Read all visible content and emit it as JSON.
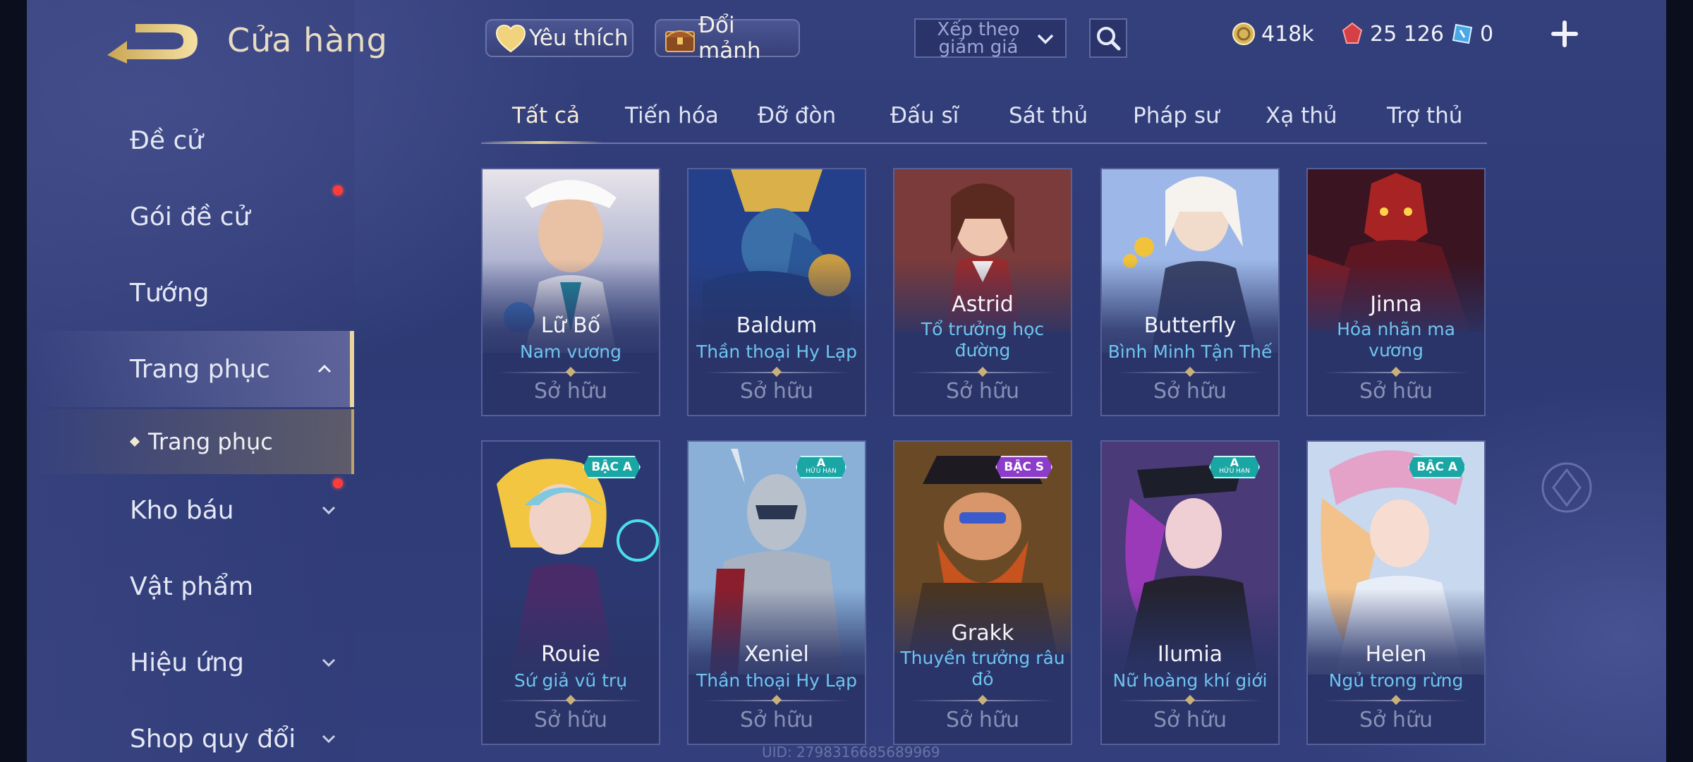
{
  "header": {
    "title": "Cửa hàng",
    "favorites_label": "Yêu thích",
    "exchange_label": "Đổi mảnh",
    "sort_label": "Xếp theo giảm giá",
    "gold": "418k",
    "vouchers": "25 126",
    "tickets": "0"
  },
  "sidebar": {
    "items": [
      {
        "label": "Đề cử"
      },
      {
        "label": "Gói đề cử"
      },
      {
        "label": "Tướng"
      },
      {
        "label": "Trang phục"
      },
      {
        "label": "Trang phục"
      },
      {
        "label": "Kho báu"
      },
      {
        "label": "Vật phẩm"
      },
      {
        "label": "Hiệu ứng"
      },
      {
        "label": "Shop quy đổi"
      }
    ]
  },
  "tabs": [
    "Tất cả",
    "Tiến hóa",
    "Đỡ đòn",
    "Đấu sĩ",
    "Sát thủ",
    "Pháp sư",
    "Xạ thủ",
    "Trợ thủ"
  ],
  "cards": [
    {
      "hero": "Lữ Bố",
      "skin": "Nam vương",
      "status": "Sở hữu",
      "badge": ""
    },
    {
      "hero": "Baldum",
      "skin": "Thần thoại Hy Lạp",
      "status": "Sở hữu",
      "badge": ""
    },
    {
      "hero": "Astrid",
      "skin": "Tổ trưởng học đường",
      "status": "Sở hữu",
      "badge": ""
    },
    {
      "hero": "Butterfly",
      "skin": "Bình Minh Tận Thế",
      "status": "Sở hữu",
      "badge": ""
    },
    {
      "hero": "Jinna",
      "skin": "Hỏa nhãn ma vương",
      "status": "Sở hữu",
      "badge": ""
    },
    {
      "hero": "Rouie",
      "skin": "Sứ giả vũ trụ",
      "status": "Sở hữu",
      "badge": "BẬC A"
    },
    {
      "hero": "Xeniel",
      "skin": "Thần thoại Hy Lạp",
      "status": "Sở hữu",
      "badge": "A",
      "badge_sub": "HỮU HẠN"
    },
    {
      "hero": "Grakk",
      "skin": "Thuyền trưởng râu đỏ",
      "status": "Sở hữu",
      "badge": "BẬC S"
    },
    {
      "hero": "Ilumia",
      "skin": "Nữ hoàng khí giới",
      "status": "Sở hữu",
      "badge": "A",
      "badge_sub": "HỮU HẠN"
    },
    {
      "hero": "Helen",
      "skin": "Ngủ trong rừng",
      "status": "Sở hữu",
      "badge": "BẬC A"
    }
  ],
  "footer": {
    "uid": "UID: 2798316685689969"
  },
  "colors": {
    "accent_gold": "#e9d59d",
    "skin_blue": "#6fc4f0",
    "notify_red": "#ff3b3b"
  }
}
